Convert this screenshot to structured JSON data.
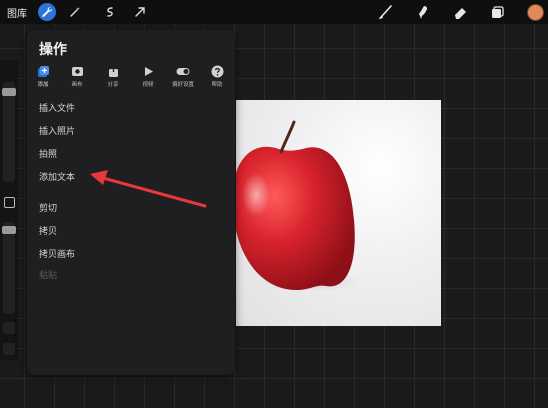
{
  "topbar": {
    "gallery_label": "图库",
    "left_tools": [
      "wrench-icon",
      "magic-wand-icon",
      "selection-icon",
      "transform-arrow-icon"
    ],
    "right_tools": [
      "brush-icon",
      "smudge-icon",
      "eraser-icon",
      "layers-icon"
    ],
    "color_swatch": "#e08a5a"
  },
  "panel": {
    "title": "操作",
    "tabs": [
      {
        "label": "添加",
        "icon": "add-icon",
        "active": true
      },
      {
        "label": "画布",
        "icon": "canvas-icon",
        "active": false
      },
      {
        "label": "分享",
        "icon": "share-icon",
        "active": false
      },
      {
        "label": "视频",
        "icon": "video-icon",
        "active": false
      },
      {
        "label": "偏好设置",
        "icon": "toggle-icon",
        "active": false
      },
      {
        "label": "帮助",
        "icon": "help-icon",
        "active": false
      }
    ],
    "items": [
      {
        "label": "插入文件",
        "enabled": true
      },
      {
        "label": "插入照片",
        "enabled": true
      },
      {
        "label": "拍照",
        "enabled": true
      },
      {
        "label": "添加文本",
        "enabled": true
      },
      {
        "label": "剪切",
        "enabled": true
      },
      {
        "label": "拷贝",
        "enabled": true
      },
      {
        "label": "拷贝画布",
        "enabled": true
      },
      {
        "label": "粘贴",
        "enabled": false
      }
    ]
  },
  "colors": {
    "accent": "#2d74d8",
    "annotation_arrow": "#e8383b",
    "apple_red": "#d8232c"
  }
}
